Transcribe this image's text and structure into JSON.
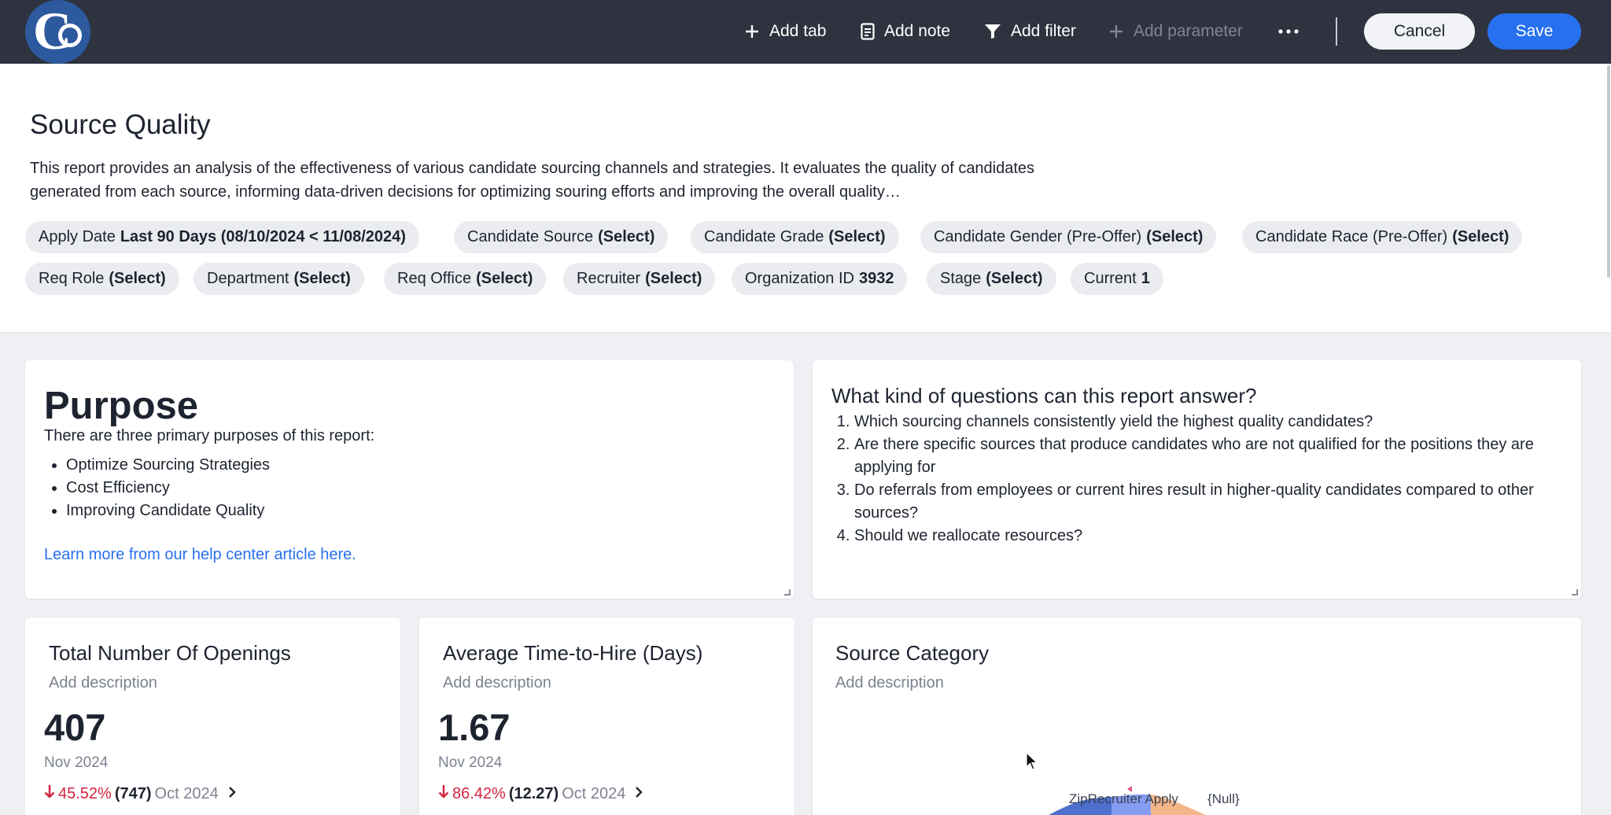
{
  "toolbar": {
    "add_tab": "Add tab",
    "add_note": "Add note",
    "add_filter": "Add filter",
    "add_parameter": "Add parameter",
    "cancel": "Cancel",
    "save": "Save"
  },
  "logo": {
    "c": "C",
    "o": "o"
  },
  "header": {
    "title": "Source Quality",
    "description": "This report provides an analysis of the effectiveness of various candidate sourcing channels and strategies. It evaluates the quality of candidates generated from each source, informing data-driven decisions for optimizing souring efforts and improving the overall quality…"
  },
  "filters": [
    {
      "label": "Apply Date",
      "value": "Last 90 Days (08/10/2024 < 11/08/2024)"
    },
    {
      "label": "Candidate Source",
      "value": "(Select)"
    },
    {
      "label": "Candidate Grade",
      "value": "(Select)"
    },
    {
      "label": "Candidate Gender (Pre-Offer)",
      "value": "(Select)"
    },
    {
      "label": "Candidate Race (Pre-Offer)",
      "value": "(Select)"
    },
    {
      "label": "Req Role",
      "value": "(Select)"
    },
    {
      "label": "Department",
      "value": "(Select)"
    },
    {
      "label": "Req Office",
      "value": "(Select)"
    },
    {
      "label": "Recruiter",
      "value": "(Select)"
    },
    {
      "label": "Organization ID",
      "value": "3932"
    },
    {
      "label": "Stage",
      "value": "(Select)"
    },
    {
      "label": "Current",
      "value": "1"
    }
  ],
  "purpose": {
    "title": "Purpose",
    "intro": "There are three primary purposes of this report:",
    "items": [
      "Optimize Sourcing Strategies",
      "Cost Efficiency",
      "Improving Candidate Quality"
    ],
    "link": "Learn more from our help center article here."
  },
  "questions": {
    "title": "What kind of questions can this report answer?",
    "items": [
      "Which sourcing channels consistently yield the highest quality candidates?",
      "Are there specific sources that produce candidates who are not qualified for the positions they are applying for",
      "Do referrals from employees or current hires result in higher-quality candidates compared to other sources?",
      "Should we reallocate resources?"
    ]
  },
  "kpis": [
    {
      "title": "Total Number Of Openings",
      "description": "Add description",
      "value": "407",
      "period": "Nov 2024",
      "change": "45.52%",
      "previous": "(747)",
      "previous_period": "Oct 2024"
    },
    {
      "title": "Average Time-to-Hire (Days)",
      "description": "Add description",
      "value": "1.67",
      "period": "Nov 2024",
      "change": "86.42%",
      "previous": "(12.27)",
      "previous_period": "Oct 2024"
    }
  ],
  "source_category": {
    "title": "Source Category",
    "description": "Add description",
    "labels": [
      "ZipRecruiter Apply",
      "{Null}"
    ]
  },
  "colors": {
    "topbar": "#2e333f",
    "accent": "#2770ef",
    "negative": "#d4233e"
  },
  "icons": [
    "plus-icon",
    "note-icon",
    "filter-icon",
    "more-icon",
    "down-arrow-icon",
    "chevron-right-icon",
    "cursor-icon"
  ]
}
